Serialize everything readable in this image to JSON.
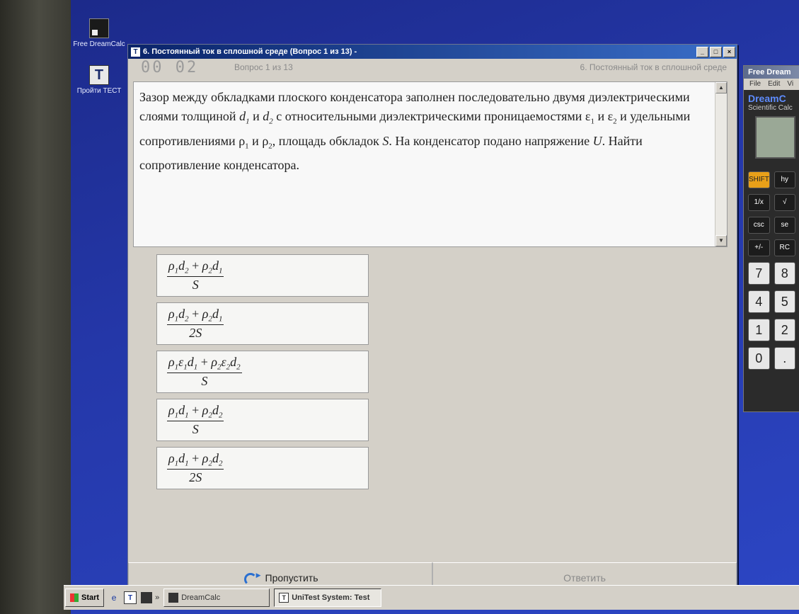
{
  "desktop": {
    "icons": [
      {
        "label": "Free DreamCalc",
        "icon": "calculator-icon"
      },
      {
        "label": "Пройти ТЕСТ",
        "icon": "test-app-icon"
      }
    ]
  },
  "window": {
    "title": "6. Постоянный ток в сплошной среде (Вопрос 1 из 13) -",
    "controls": [
      "minimize",
      "maximize",
      "close"
    ]
  },
  "info": {
    "timer": "00 02",
    "counter": "Вопрос 1 из 13",
    "topic": "6. Постоянный ток в сплошной среде"
  },
  "question": {
    "segments": [
      {
        "t": "Зазор между обкладками плоского конденсатора заполнен последовательно двумя диэлектрическими слоями толщиной "
      },
      {
        "t": "d",
        "sub": "1",
        "i": true
      },
      {
        "t": " и "
      },
      {
        "t": "d",
        "sub": "2",
        "i": true
      },
      {
        "t": " с относительными диэлектрическими проницаемостями "
      },
      {
        "t": "ε",
        "sub": "1"
      },
      {
        "t": " и "
      },
      {
        "t": "ε",
        "sub": "2"
      },
      {
        "t": " и удельными сопротивлениями "
      },
      {
        "t": "ρ",
        "sub": "1"
      },
      {
        "t": " и "
      },
      {
        "t": "ρ",
        "sub": "2"
      },
      {
        "t": ", площадь обкладок "
      },
      {
        "t": "S",
        "i": true
      },
      {
        "t": ". На конденсатор подано напряжение "
      },
      {
        "t": "U",
        "i": true
      },
      {
        "t": ". Найти сопротивление конденсатора."
      }
    ]
  },
  "answers": [
    {
      "num": [
        [
          "ρ",
          "1"
        ],
        [
          "d",
          "2"
        ],
        [
          " + ",
          ""
        ],
        [
          "ρ",
          "2"
        ],
        [
          "d",
          "1"
        ]
      ],
      "den": "S"
    },
    {
      "num": [
        [
          "ρ",
          "1"
        ],
        [
          "d",
          "2"
        ],
        [
          " + ",
          ""
        ],
        [
          "ρ",
          "2"
        ],
        [
          "d",
          "1"
        ]
      ],
      "den": "2S"
    },
    {
      "num": [
        [
          "ρ",
          "1"
        ],
        [
          "ε",
          "1"
        ],
        [
          "d",
          "1"
        ],
        [
          " + ",
          ""
        ],
        [
          "ρ",
          "2"
        ],
        [
          "ε",
          "2"
        ],
        [
          "d",
          "2"
        ]
      ],
      "den": "S"
    },
    {
      "num": [
        [
          "ρ",
          "1"
        ],
        [
          "d",
          "1"
        ],
        [
          " + ",
          ""
        ],
        [
          "ρ",
          "2"
        ],
        [
          "d",
          "2"
        ]
      ],
      "den": "S"
    },
    {
      "num": [
        [
          "ρ",
          "1"
        ],
        [
          "d",
          "1"
        ],
        [
          " + ",
          ""
        ],
        [
          "ρ",
          "2"
        ],
        [
          "d",
          "2"
        ]
      ],
      "den": "2S"
    }
  ],
  "footer": {
    "skip_label": "Пропустить",
    "answer_label": "Ответить"
  },
  "calculator": {
    "title": "Free Dream",
    "menu": [
      "File",
      "Edit",
      "Vi"
    ],
    "brand": "DreamC",
    "model": "Scientific Calc",
    "keys": [
      [
        "SHIFT",
        "hy"
      ],
      [
        "1/x",
        "√"
      ],
      [
        "csc",
        "se"
      ],
      [
        "+/-",
        "RC"
      ],
      [
        "7",
        "8"
      ],
      [
        "4",
        "5"
      ],
      [
        "1",
        "2"
      ],
      [
        "0",
        "."
      ]
    ]
  },
  "taskbar": {
    "start_label": "Start",
    "tasks": [
      {
        "label": "DreamCalc",
        "icon": "calculator-icon",
        "active": false
      },
      {
        "label": "UniTest System: Test",
        "icon": "test-app-icon",
        "active": true
      }
    ]
  }
}
